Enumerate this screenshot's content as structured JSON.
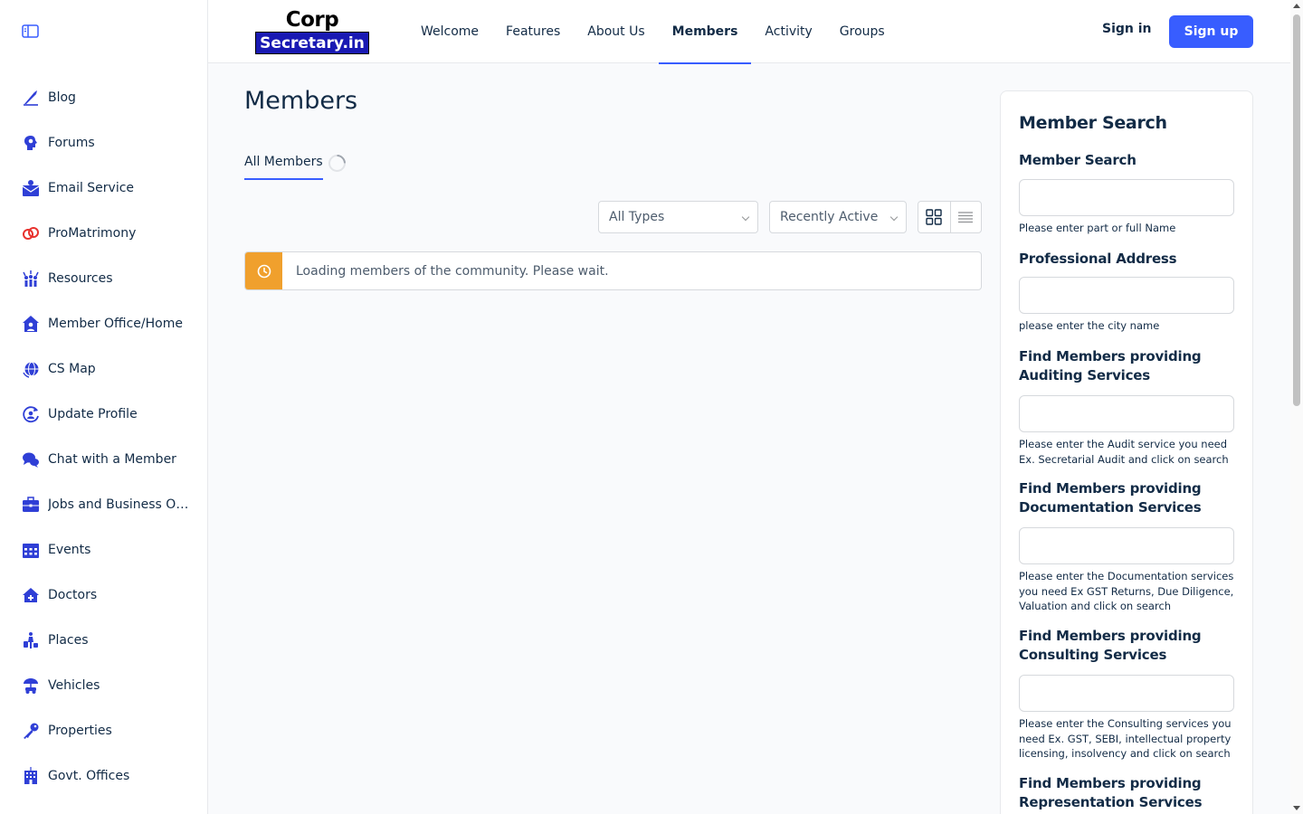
{
  "sidebar": {
    "items": [
      {
        "label": "Blog",
        "icon": "quill-icon"
      },
      {
        "label": "Forums",
        "icon": "head-gear-icon"
      },
      {
        "label": "Email Service",
        "icon": "envelope-person-icon"
      },
      {
        "label": "ProMatrimony",
        "icon": "rings-icon"
      },
      {
        "label": "Resources",
        "icon": "people-hands-icon"
      },
      {
        "label": "Member Office/Home",
        "icon": "home-person-icon"
      },
      {
        "label": "CS Map",
        "icon": "globe-icon"
      },
      {
        "label": "Update Profile",
        "icon": "profile-refresh-icon"
      },
      {
        "label": "Chat with a Member",
        "icon": "chat-bubbles-icon"
      },
      {
        "label": "Jobs and Business Opp...",
        "icon": "briefcase-icon"
      },
      {
        "label": "Events",
        "icon": "calendar-icon"
      },
      {
        "label": "Doctors",
        "icon": "medical-home-icon"
      },
      {
        "label": "Places",
        "icon": "traveler-icon"
      },
      {
        "label": "Vehicles",
        "icon": "vehicle-umbrella-icon"
      },
      {
        "label": "Properties",
        "icon": "key-icon"
      },
      {
        "label": "Govt. Offices",
        "icon": "building-icon"
      }
    ]
  },
  "header": {
    "logo_line1": "Corp",
    "logo_line2": "Secretary.in",
    "nav": [
      "Welcome",
      "Features",
      "About Us",
      "Members",
      "Activity",
      "Groups"
    ],
    "active_nav": "Members",
    "signin": "Sign in",
    "signup": "Sign up"
  },
  "main": {
    "title": "Members",
    "tab_label": "All Members",
    "filter_type": "All Types",
    "filter_order": "Recently Active",
    "notice": "Loading members of the community. Please wait."
  },
  "panel": {
    "title": "Member Search",
    "fields": [
      {
        "label": "Member Search",
        "help": "Please enter part or full Name"
      },
      {
        "label": "Professional Address",
        "help": "please enter the city name"
      },
      {
        "label": "Find Members providing Auditing Services",
        "help": "Please enter the Audit service you need Ex. Secretarial Audit and click on search"
      },
      {
        "label": "Find Members providing Documentation Services",
        "help": "Please enter the Documentation services you need Ex GST Returns, Due Diligence, Valuation and click on search"
      },
      {
        "label": "Find Members providing Consulting Services",
        "help": "Please enter the Consulting services you need Ex. GST, SEBI, intellectual property licensing, insolvency and click on search"
      },
      {
        "label": "Find Members providing Representation Services",
        "help": ""
      }
    ]
  },
  "colors": {
    "accent": "#385dff",
    "icon": "#2f3fd6",
    "notice": "#f0a02d",
    "logo_bg": "#1919b3"
  }
}
